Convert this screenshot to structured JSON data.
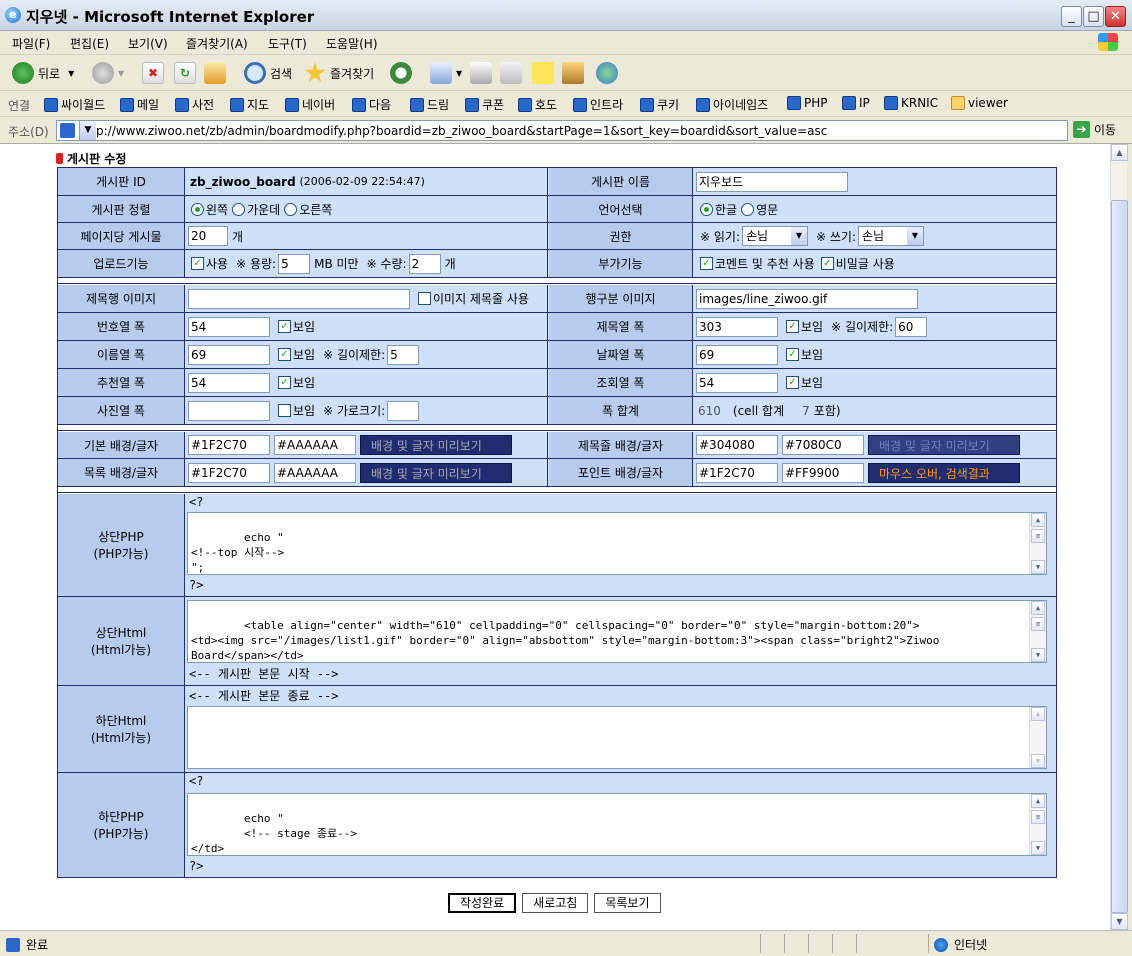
{
  "window": {
    "title": "지우넷 - Microsoft Internet Explorer"
  },
  "menu": [
    "파일(F)",
    "편집(E)",
    "보기(V)",
    "즐겨찾기(A)",
    "도구(T)",
    "도움말(H)"
  ],
  "toolbar": {
    "back": "뒤로",
    "search": "검색",
    "favorites": "즐겨찾기"
  },
  "links": {
    "label": "연결",
    "items": [
      "싸이월드",
      "메일",
      "사전",
      "지도",
      "네이버",
      "다음",
      "드림",
      "쿠폰",
      "호도",
      "인트라",
      "쿠키",
      "아이네임즈",
      "PHP",
      "IP",
      "KRNIC",
      "viewer"
    ]
  },
  "address": {
    "label": "주소(D)",
    "url": "http://www.ziwoo.net/zb/admin/boardmodify.php?boardid=zb_ziwoo_board&startPage=1&sort_key=boardid&sort_value=asc",
    "go": "이동"
  },
  "status": {
    "text": "완료",
    "zone": "인터넷"
  },
  "page": {
    "heading": "게시판 수정",
    "board_id_label": "게시판 ID",
    "board_id": "zb_ziwoo_board",
    "board_date": "(2006-02-09 22:54:47)",
    "board_name_label": "게시판 이름",
    "board_name": "지우보드",
    "align_label": "게시판 정렬",
    "align_opts": [
      "왼쪽",
      "가운데",
      "오른쪽"
    ],
    "lang_label": "언어선택",
    "lang_opts": [
      "한글",
      "영문"
    ],
    "per_page_label": "페이지당 게시물",
    "per_page": "20",
    "per_page_unit": "개",
    "perm_label": "권한",
    "read_label": "※ 읽기:",
    "read_val": "손님",
    "write_label": "※ 쓰기:",
    "write_val": "손님",
    "upload_label": "업로드기능",
    "upload_use": "사용",
    "size_label": "※ 용량:",
    "size_val": "5",
    "size_unit": "MB 미만",
    "count_label": "※ 수량:",
    "count_val": "2",
    "count_unit": "개",
    "extra_label": "부가기능",
    "extra_comment": "코멘트 및 추천 사용",
    "extra_secret": "비밀글 사용",
    "title_img_label": "제목행 이미지",
    "title_img_val": "",
    "title_img_use": "이미지 제목줄 사용",
    "line_img_label": "행구분 이미지",
    "line_img_val": "images/line_ziwoo.gif",
    "no_col_label": "번호열 폭",
    "no_col": "54",
    "show": "보임",
    "subj_col_label": "제목열 폭",
    "subj_col": "303",
    "limit_label": "※ 길이제한:",
    "subj_limit": "60",
    "name_col_label": "이름열 폭",
    "name_col": "69",
    "name_limit": "5",
    "date_col_label": "날짜열 폭",
    "date_col": "69",
    "rec_col_label": "추천열 폭",
    "rec_col": "54",
    "view_col_label": "조회열 폭",
    "view_col": "54",
    "photo_col_label": "사진열 폭",
    "photo_col": "",
    "photo_width_label": "※ 가로크기:",
    "photo_width": "",
    "sum_label": "폭 합계",
    "sum_val": "610",
    "sum_cell_a": "(cell 합계",
    "sum_cell_n": "7",
    "sum_cell_b": "포함)",
    "base_color_label": "기본 배경/글자",
    "base_bg": "#1F2C70",
    "base_fg": "#AAAAAA",
    "preview_label": "배경 및 글자 미리보기",
    "titlebar_color_label": "제목줄 배경/글자",
    "titlebar_bg": "#304080",
    "titlebar_fg": "#7080C0",
    "list_color_label": "목록 배경/글자",
    "list_bg": "#1F2C70",
    "list_fg": "#AAAAAA",
    "point_color_label": "포인트 배경/글자",
    "point_bg": "#1F2C70",
    "point_fg": "#FF9900",
    "point_preview": "마우스 오버, 검색결과",
    "top_php_label": "상단PHP",
    "top_php_sub": "(PHP가능)",
    "php_open": "<?",
    "php_close": "?>",
    "top_php_code": "echo \"\n<!--top 시작-->\n\";\ninclude '../include/subtop.php';",
    "top_html_label": "상단Html",
    "top_html_sub": "(Html가능)",
    "top_html_code": "<table align=\"center\" width=\"610\" cellpadding=\"0\" cellspacing=\"0\" border=\"0\" style=\"margin-bottom:20\">\n<td><img src=\"/images/list1.gif\" border=\"0\" align=\"absbottom\" style=\"margin-bottom:3\"><span class=\"bright2\">Ziwoo\nBoard</span></td>\n</table>",
    "body_start": "<-- 게시판 본문 시작 -->",
    "bot_html_label": "하단Html",
    "bot_html_sub": "(Html가능)",
    "body_end": "<-- 게시판 본문 종료 -->",
    "bot_html_code": "",
    "bot_php_label": "하단PHP",
    "bot_php_sub": "(PHP가능)",
    "bot_php_code": "echo \"\n        <!-- stage 종료-->\n</td>\n</tr>",
    "btn_save": "작성완료",
    "btn_reload": "새로고침",
    "btn_list": "목록보기"
  },
  "colors": {
    "header_bg": "#b7cbed",
    "row_bg": "#cde0f7",
    "border": "#1f2c70",
    "point_fg": "#ff9900"
  }
}
